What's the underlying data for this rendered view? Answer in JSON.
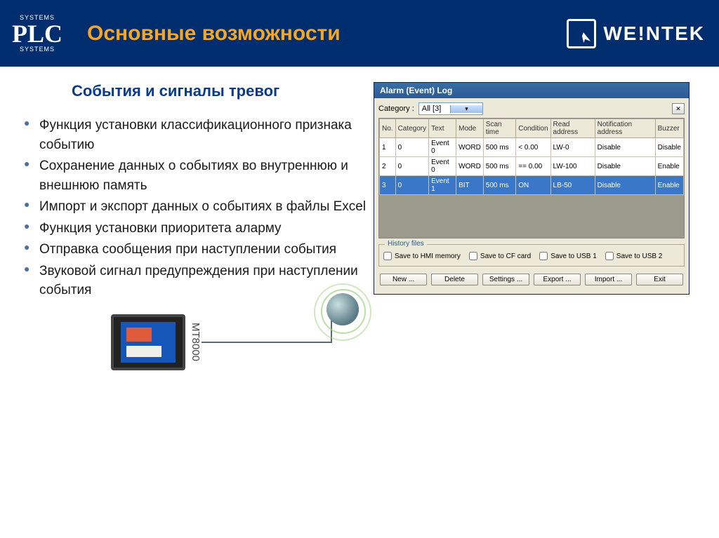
{
  "header": {
    "title": "Основные возможности",
    "brand_logo_text": "WE!NTEK",
    "plc_top": "SYSTEMS",
    "plc_mid": "PLC",
    "plc_bot": "SYSTEMS"
  },
  "subtitle": "События и сигналы тревог",
  "bullets": [
    "Функция установки классификационного признака событию",
    "Сохранение данных о событиях во внутреннюю и внешнюю память",
    "Импорт и экспорт данных о событиях в файлы Excel",
    "Функция установки приоритета аларму",
    "Отправка сообщения при наступлении события",
    "Звуковой сигнал предупреждения при наступлении события"
  ],
  "dialog": {
    "title": "Alarm (Event) Log",
    "category_label": "Category :",
    "category_value": "All [3]",
    "close_icon": "✕",
    "columns": [
      "No.",
      "Category",
      "Text",
      "Mode",
      "Scan time",
      "Condition",
      "Read address",
      "Notification address",
      "Buzzer"
    ],
    "rows": [
      {
        "no": "1",
        "cat": "0",
        "text": "Event 0",
        "mode": "WORD",
        "scan": "500 ms",
        "cond": "<  0.00",
        "addr": "LW-0",
        "notif": "Disable",
        "buzz": "Disable"
      },
      {
        "no": "2",
        "cat": "0",
        "text": "Event 0",
        "mode": "WORD",
        "scan": "500 ms",
        "cond": "== 0.00",
        "addr": "LW-100",
        "notif": "Disable",
        "buzz": "Enable"
      },
      {
        "no": "3",
        "cat": "0",
        "text": "Event 1",
        "mode": "BIT",
        "scan": "500 ms",
        "cond": "ON",
        "addr": "LB-50",
        "notif": "Disable",
        "buzz": "Enable"
      }
    ],
    "history_label": "History files",
    "checks": [
      "Save to HMI memory",
      "Save to CF card",
      "Save to USB 1",
      "Save to USB 2"
    ],
    "buttons": [
      "New ...",
      "Delete",
      "Settings ...",
      "Export ...",
      "Import ...",
      "Exit"
    ]
  },
  "device_label": "MT8000"
}
